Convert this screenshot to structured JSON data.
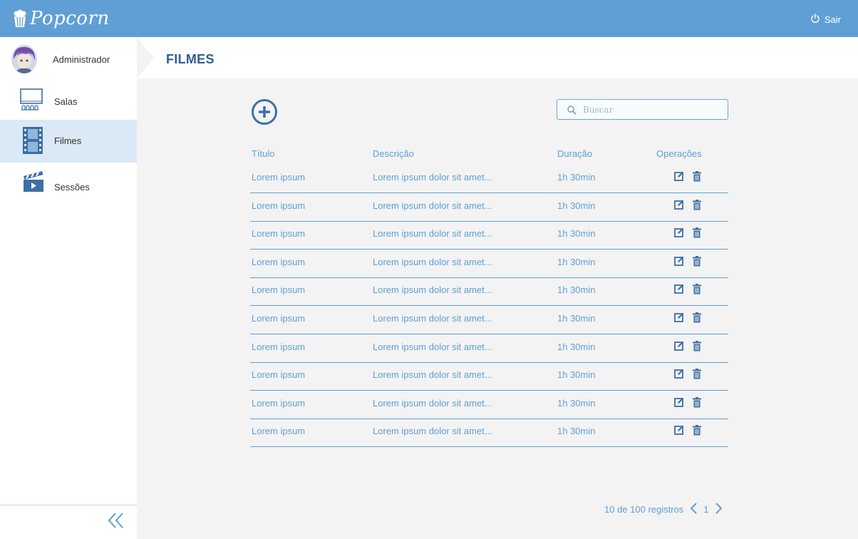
{
  "app": {
    "name": "Popcorn",
    "logout_label": "Sair"
  },
  "user": {
    "name": "Administrador"
  },
  "sidebar": {
    "items": [
      {
        "label": "Salas",
        "icon": "cinema-screen-icon"
      },
      {
        "label": "Filmes",
        "icon": "film-strip-icon",
        "active": true
      },
      {
        "label": "Sessões",
        "icon": "clapperboard-icon"
      }
    ]
  },
  "page": {
    "title": "FILMES"
  },
  "search": {
    "placeholder": "Buscar",
    "value": ""
  },
  "table": {
    "columns": [
      "Título",
      "Descrição",
      "Duração",
      "Operações"
    ],
    "rows": [
      {
        "title": "Lorem ipsum",
        "description": "Lorem ipsum dolor sit amet...",
        "duration": "1h 30min"
      },
      {
        "title": "Lorem ipsum",
        "description": "Lorem ipsum dolor sit amet...",
        "duration": "1h 30min"
      },
      {
        "title": "Lorem ipsum",
        "description": "Lorem ipsum dolor sit amet...",
        "duration": "1h 30min"
      },
      {
        "title": "Lorem ipsum",
        "description": "Lorem ipsum dolor sit amet...",
        "duration": "1h 30min"
      },
      {
        "title": "Lorem ipsum",
        "description": "Lorem ipsum dolor sit amet...",
        "duration": "1h 30min"
      },
      {
        "title": "Lorem ipsum",
        "description": "Lorem ipsum dolor sit amet...",
        "duration": "1h 30min"
      },
      {
        "title": "Lorem ipsum",
        "description": "Lorem ipsum dolor sit amet...",
        "duration": "1h 30min"
      },
      {
        "title": "Lorem ipsum",
        "description": "Lorem ipsum dolor sit amet...",
        "duration": "1h 30min"
      },
      {
        "title": "Lorem ipsum",
        "description": "Lorem ipsum dolor sit amet...",
        "duration": "1h 30min"
      },
      {
        "title": "Lorem ipsum",
        "description": "Lorem ipsum dolor sit amet...",
        "duration": "1h 30min"
      }
    ]
  },
  "pagination": {
    "summary": "10 de 100 registros",
    "current_page": "1"
  },
  "colors": {
    "accent": "#5f9fd6",
    "title": "#2f5f8f",
    "active_nav": "#dbe9f6",
    "background": "#f3f3f3"
  }
}
